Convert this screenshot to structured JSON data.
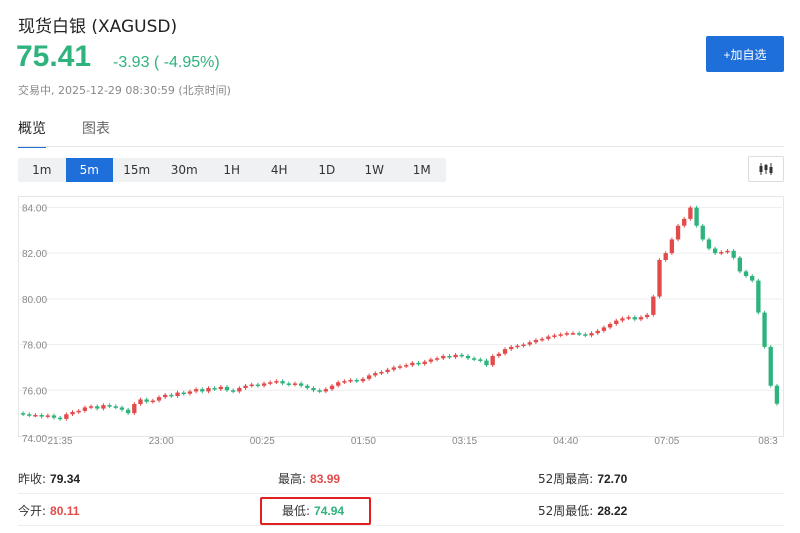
{
  "header": {
    "title": "现货白银  (XAGUSD)",
    "price": "75.41",
    "change": "-3.93 ( -4.95%)",
    "trade_time": "交易中, 2025-12-29 08:30:59 (北京时间)",
    "add_button": "+加自选"
  },
  "tabs": [
    {
      "label": "概览",
      "active": true
    },
    {
      "label": "图表",
      "active": false
    }
  ],
  "timeframes": [
    {
      "label": "1m",
      "active": false
    },
    {
      "label": "5m",
      "active": true
    },
    {
      "label": "15m",
      "active": false
    },
    {
      "label": "30m",
      "active": false
    },
    {
      "label": "1H",
      "active": false
    },
    {
      "label": "4H",
      "active": false
    },
    {
      "label": "1D",
      "active": false
    },
    {
      "label": "1W",
      "active": false
    },
    {
      "label": "1M",
      "active": false
    }
  ],
  "chart_type_icon": "candlestick-icon",
  "colors": {
    "up": "#e34b4b",
    "down": "#2eb37c",
    "accent": "#1e6fd9"
  },
  "chart_data": {
    "type": "candlestick",
    "title": "",
    "xlabel": "",
    "ylabel": "",
    "ylim": [
      74,
      84.5
    ],
    "y_ticks": [
      76,
      78,
      80,
      82,
      84
    ],
    "y_tick_labels": [
      "76.00",
      "78.00",
      "80.00",
      "82.00",
      "84.00"
    ],
    "y_bottom_label": "74.00",
    "x_tick_labels": [
      "21:35",
      "23:00",
      "00:25",
      "01:50",
      "03:15",
      "04:40",
      "07:05",
      "08:3"
    ],
    "grid": true,
    "closes": [
      74.95,
      74.9,
      74.92,
      74.85,
      74.9,
      74.8,
      74.75,
      74.95,
      75.05,
      75.1,
      75.25,
      75.3,
      75.2,
      75.35,
      75.3,
      75.25,
      75.15,
      75.0,
      75.4,
      75.6,
      75.5,
      75.55,
      75.7,
      75.8,
      75.75,
      75.9,
      75.85,
      75.95,
      76.05,
      75.95,
      76.1,
      76.05,
      76.15,
      76.0,
      75.95,
      76.1,
      76.2,
      76.25,
      76.2,
      76.3,
      76.35,
      76.4,
      76.3,
      76.25,
      76.3,
      76.2,
      76.1,
      76.0,
      75.95,
      76.05,
      76.2,
      76.35,
      76.4,
      76.45,
      76.4,
      76.5,
      76.65,
      76.75,
      76.8,
      76.9,
      77.0,
      77.05,
      77.1,
      77.2,
      77.15,
      77.25,
      77.35,
      77.4,
      77.5,
      77.45,
      77.55,
      77.5,
      77.4,
      77.35,
      77.3,
      77.1,
      77.5,
      77.6,
      77.8,
      77.9,
      77.95,
      78.0,
      78.1,
      78.2,
      78.25,
      78.35,
      78.4,
      78.45,
      78.5,
      78.5,
      78.45,
      78.4,
      78.5,
      78.6,
      78.75,
      78.9,
      79.05,
      79.15,
      79.2,
      79.1,
      79.2,
      79.3,
      80.1,
      81.7,
      82.0,
      82.6,
      83.2,
      83.5,
      83.99,
      83.2,
      82.6,
      82.2,
      82.0,
      82.05,
      82.1,
      81.8,
      81.2,
      81.0,
      80.8,
      79.4,
      77.9,
      76.2,
      75.41
    ]
  },
  "stats": {
    "row1": [
      {
        "label": "昨收:",
        "value": "79.34",
        "color": "dark"
      },
      {
        "label": "最高:",
        "value": "83.99",
        "color": "red"
      },
      {
        "label": "52周最高:",
        "value": "72.70",
        "color": "dark"
      }
    ],
    "row2": [
      {
        "label": "今开:",
        "value": "80.11",
        "color": "red"
      },
      {
        "label": "最低:",
        "value": "74.94",
        "color": "green"
      },
      {
        "label": "52周最低:",
        "value": "28.22",
        "color": "dark"
      }
    ]
  }
}
